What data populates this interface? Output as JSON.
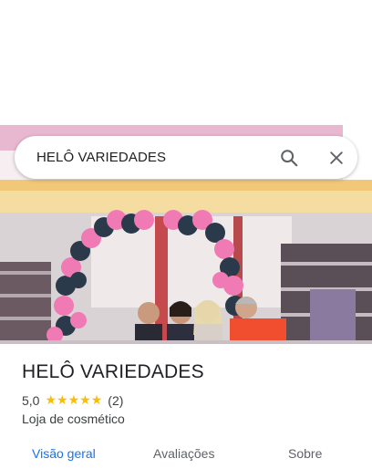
{
  "search": {
    "query": "HELÔ VARIEDADES",
    "search_icon": "search-icon",
    "close_icon": "close-icon"
  },
  "hero": {
    "image": "store-front-photo",
    "description_icon": "balloon-arch"
  },
  "place": {
    "name": "HELÔ VARIEDADES",
    "rating": "5,0",
    "stars": [
      "★",
      "★",
      "★",
      "★",
      "★"
    ],
    "review_count": "(2)",
    "category": "Loja de cosmético"
  },
  "tabs": [
    {
      "label": "Visão geral",
      "active": true
    },
    {
      "label": "Avaliações",
      "active": false
    },
    {
      "label": "Sobre",
      "active": false
    }
  ],
  "colors": {
    "accent": "#1a73e8",
    "star": "#fbbc04",
    "text": "#202124",
    "secondary_text": "#5f6368"
  }
}
